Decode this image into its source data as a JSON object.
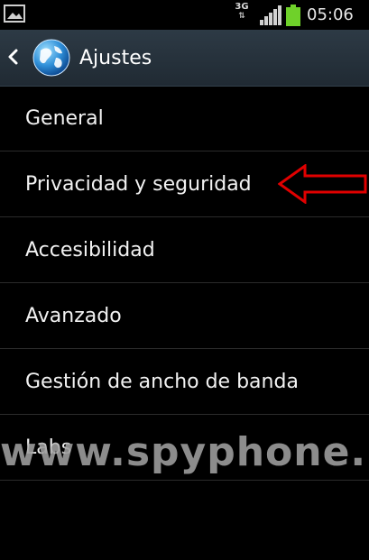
{
  "status_bar": {
    "network_type": "3G",
    "network_arrows": "⇅",
    "time": "05:06",
    "left_icon": "image-icon",
    "signal_icon": "signal-bars-icon",
    "battery_icon": "battery-icon"
  },
  "action_bar": {
    "title": "Ajustes",
    "back_icon": "chevron-left-icon",
    "app_icon": "globe-icon"
  },
  "menu": {
    "items": [
      {
        "label": "General"
      },
      {
        "label": "Privacidad y seguridad"
      },
      {
        "label": "Accesibilidad"
      },
      {
        "label": "Avanzado"
      },
      {
        "label": "Gestión de ancho de banda"
      },
      {
        "label": "Labs"
      }
    ]
  },
  "annotation": {
    "arrow_color": "#e00000"
  },
  "watermark": {
    "text": "www.spyphone.me"
  },
  "colors": {
    "background": "#000000",
    "action_bar": "#27323c",
    "text": "#f2f2f2",
    "battery": "#6fd12a",
    "globe": "#2f8fd8"
  }
}
